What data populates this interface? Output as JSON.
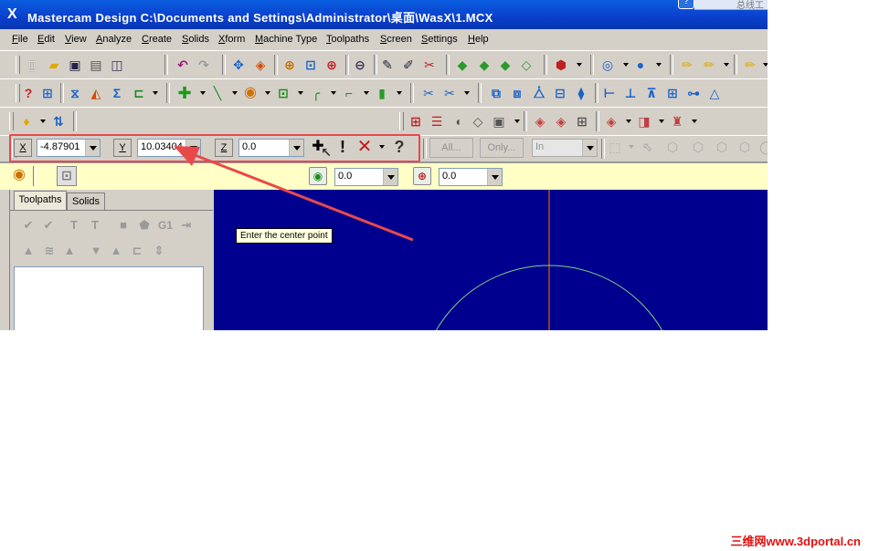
{
  "window": {
    "app_name": "Mastercam Design",
    "title": "Mastercam Design  C:\\Documents and Settings\\Administrator\\桌面\\WasX\\1.MCX",
    "corner_text": "总线工"
  },
  "menu": [
    "File",
    "Edit",
    "View",
    "Analyze",
    "Create",
    "Solids",
    "Xform",
    "Machine Type",
    "Toolpaths",
    "Screen",
    "Settings",
    "Help"
  ],
  "coords": {
    "x_label": "X",
    "x_value": "-4.87901",
    "y_label": "Y",
    "y_value": "10.03404",
    "z_label": "Z",
    "z_value": "0.0"
  },
  "selection": {
    "all_label": "All...",
    "only_label": "Only...",
    "mode_value": "In"
  },
  "ribbon": {
    "field1_value": "0.0",
    "field2_value": "0.0"
  },
  "manager": {
    "tabs": [
      "Toolpaths",
      "Solids"
    ],
    "g1_label": "G1"
  },
  "tooltip": "Enter the center point",
  "watermark": "三维网www.3dportal.cn",
  "colors": {
    "viewport_bg": "#00008e",
    "axis_line": "#c05a00",
    "circle": "#7fd07f",
    "annotation": "#e84a4a",
    "ribbon_bg": "#ffffc6"
  }
}
